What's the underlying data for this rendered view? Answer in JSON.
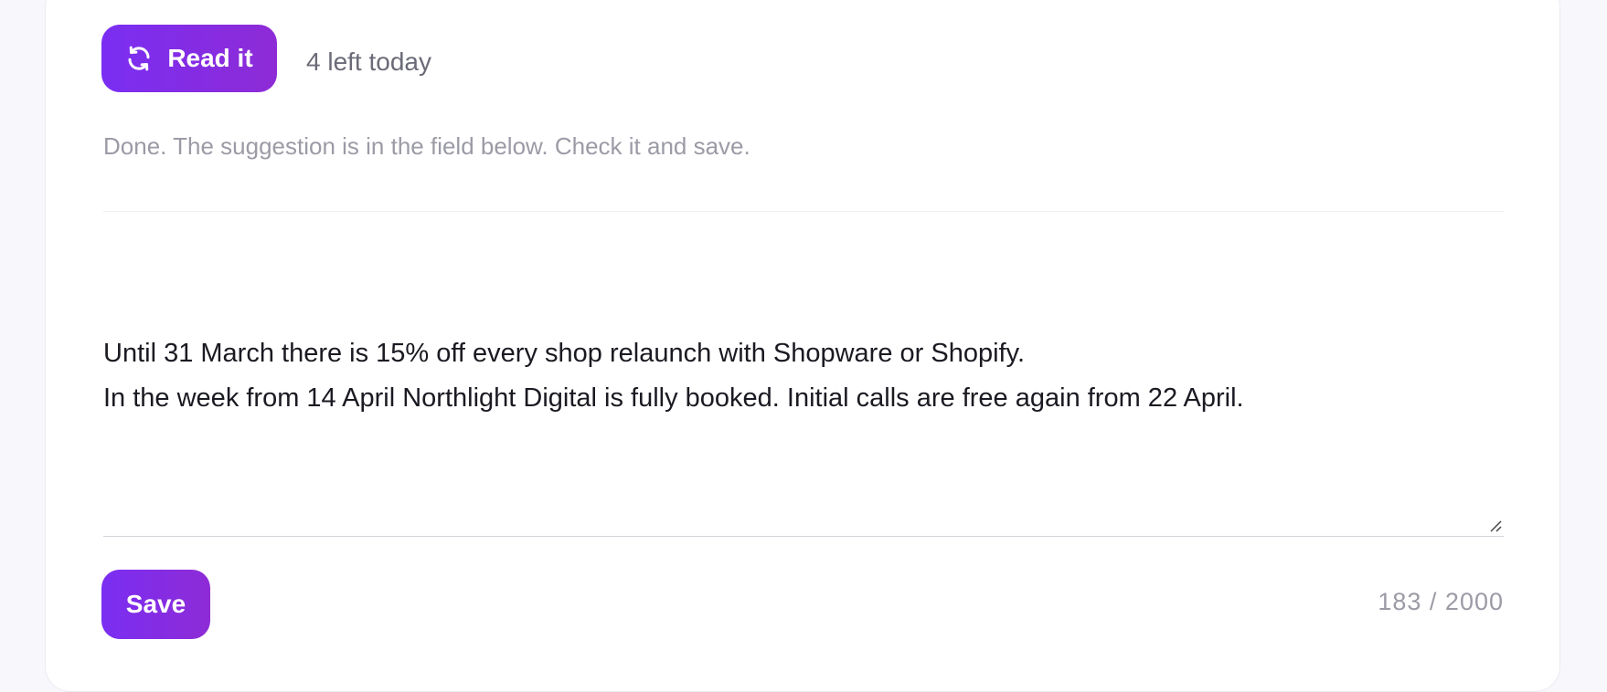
{
  "rephrase": {
    "button_label": "Read it",
    "button_icon": "refresh-icon",
    "remaining": "4 left today"
  },
  "status_message": "Done. The suggestion is in the field below. Check it and save.",
  "editor": {
    "value": "Until 31 March there is 15% off every shop relaunch with Shopware or Shopify.\nIn the week from 14 April Northlight Digital is fully booked. Initial calls are free again from 22 April."
  },
  "footer": {
    "save_label": "Save",
    "char_count": "183 / 2000"
  },
  "colors": {
    "accent_start": "#7a2ef2",
    "accent_end": "#8e2bd6",
    "muted_text": "#9b9ba6"
  }
}
